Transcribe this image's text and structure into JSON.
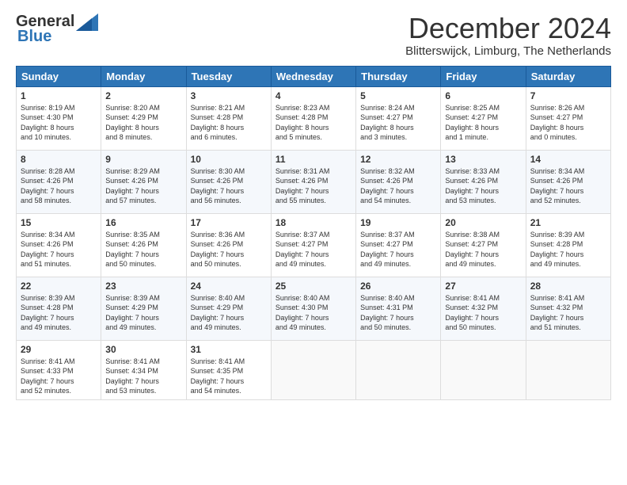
{
  "logo": {
    "general": "General",
    "blue": "Blue"
  },
  "title": "December 2024",
  "subtitle": "Blitterswijck, Limburg, The Netherlands",
  "headers": [
    "Sunday",
    "Monday",
    "Tuesday",
    "Wednesday",
    "Thursday",
    "Friday",
    "Saturday"
  ],
  "weeks": [
    [
      {
        "day": "1",
        "info": "Sunrise: 8:19 AM\nSunset: 4:30 PM\nDaylight: 8 hours\nand 10 minutes."
      },
      {
        "day": "2",
        "info": "Sunrise: 8:20 AM\nSunset: 4:29 PM\nDaylight: 8 hours\nand 8 minutes."
      },
      {
        "day": "3",
        "info": "Sunrise: 8:21 AM\nSunset: 4:28 PM\nDaylight: 8 hours\nand 6 minutes."
      },
      {
        "day": "4",
        "info": "Sunrise: 8:23 AM\nSunset: 4:28 PM\nDaylight: 8 hours\nand 5 minutes."
      },
      {
        "day": "5",
        "info": "Sunrise: 8:24 AM\nSunset: 4:27 PM\nDaylight: 8 hours\nand 3 minutes."
      },
      {
        "day": "6",
        "info": "Sunrise: 8:25 AM\nSunset: 4:27 PM\nDaylight: 8 hours\nand 1 minute."
      },
      {
        "day": "7",
        "info": "Sunrise: 8:26 AM\nSunset: 4:27 PM\nDaylight: 8 hours\nand 0 minutes."
      }
    ],
    [
      {
        "day": "8",
        "info": "Sunrise: 8:28 AM\nSunset: 4:26 PM\nDaylight: 7 hours\nand 58 minutes."
      },
      {
        "day": "9",
        "info": "Sunrise: 8:29 AM\nSunset: 4:26 PM\nDaylight: 7 hours\nand 57 minutes."
      },
      {
        "day": "10",
        "info": "Sunrise: 8:30 AM\nSunset: 4:26 PM\nDaylight: 7 hours\nand 56 minutes."
      },
      {
        "day": "11",
        "info": "Sunrise: 8:31 AM\nSunset: 4:26 PM\nDaylight: 7 hours\nand 55 minutes."
      },
      {
        "day": "12",
        "info": "Sunrise: 8:32 AM\nSunset: 4:26 PM\nDaylight: 7 hours\nand 54 minutes."
      },
      {
        "day": "13",
        "info": "Sunrise: 8:33 AM\nSunset: 4:26 PM\nDaylight: 7 hours\nand 53 minutes."
      },
      {
        "day": "14",
        "info": "Sunrise: 8:34 AM\nSunset: 4:26 PM\nDaylight: 7 hours\nand 52 minutes."
      }
    ],
    [
      {
        "day": "15",
        "info": "Sunrise: 8:34 AM\nSunset: 4:26 PM\nDaylight: 7 hours\nand 51 minutes."
      },
      {
        "day": "16",
        "info": "Sunrise: 8:35 AM\nSunset: 4:26 PM\nDaylight: 7 hours\nand 50 minutes."
      },
      {
        "day": "17",
        "info": "Sunrise: 8:36 AM\nSunset: 4:26 PM\nDaylight: 7 hours\nand 50 minutes."
      },
      {
        "day": "18",
        "info": "Sunrise: 8:37 AM\nSunset: 4:27 PM\nDaylight: 7 hours\nand 49 minutes."
      },
      {
        "day": "19",
        "info": "Sunrise: 8:37 AM\nSunset: 4:27 PM\nDaylight: 7 hours\nand 49 minutes."
      },
      {
        "day": "20",
        "info": "Sunrise: 8:38 AM\nSunset: 4:27 PM\nDaylight: 7 hours\nand 49 minutes."
      },
      {
        "day": "21",
        "info": "Sunrise: 8:39 AM\nSunset: 4:28 PM\nDaylight: 7 hours\nand 49 minutes."
      }
    ],
    [
      {
        "day": "22",
        "info": "Sunrise: 8:39 AM\nSunset: 4:28 PM\nDaylight: 7 hours\nand 49 minutes."
      },
      {
        "day": "23",
        "info": "Sunrise: 8:39 AM\nSunset: 4:29 PM\nDaylight: 7 hours\nand 49 minutes."
      },
      {
        "day": "24",
        "info": "Sunrise: 8:40 AM\nSunset: 4:29 PM\nDaylight: 7 hours\nand 49 minutes."
      },
      {
        "day": "25",
        "info": "Sunrise: 8:40 AM\nSunset: 4:30 PM\nDaylight: 7 hours\nand 49 minutes."
      },
      {
        "day": "26",
        "info": "Sunrise: 8:40 AM\nSunset: 4:31 PM\nDaylight: 7 hours\nand 50 minutes."
      },
      {
        "day": "27",
        "info": "Sunrise: 8:41 AM\nSunset: 4:32 PM\nDaylight: 7 hours\nand 50 minutes."
      },
      {
        "day": "28",
        "info": "Sunrise: 8:41 AM\nSunset: 4:32 PM\nDaylight: 7 hours\nand 51 minutes."
      }
    ],
    [
      {
        "day": "29",
        "info": "Sunrise: 8:41 AM\nSunset: 4:33 PM\nDaylight: 7 hours\nand 52 minutes."
      },
      {
        "day": "30",
        "info": "Sunrise: 8:41 AM\nSunset: 4:34 PM\nDaylight: 7 hours\nand 53 minutes."
      },
      {
        "day": "31",
        "info": "Sunrise: 8:41 AM\nSunset: 4:35 PM\nDaylight: 7 hours\nand 54 minutes."
      },
      {
        "day": "",
        "info": ""
      },
      {
        "day": "",
        "info": ""
      },
      {
        "day": "",
        "info": ""
      },
      {
        "day": "",
        "info": ""
      }
    ]
  ]
}
